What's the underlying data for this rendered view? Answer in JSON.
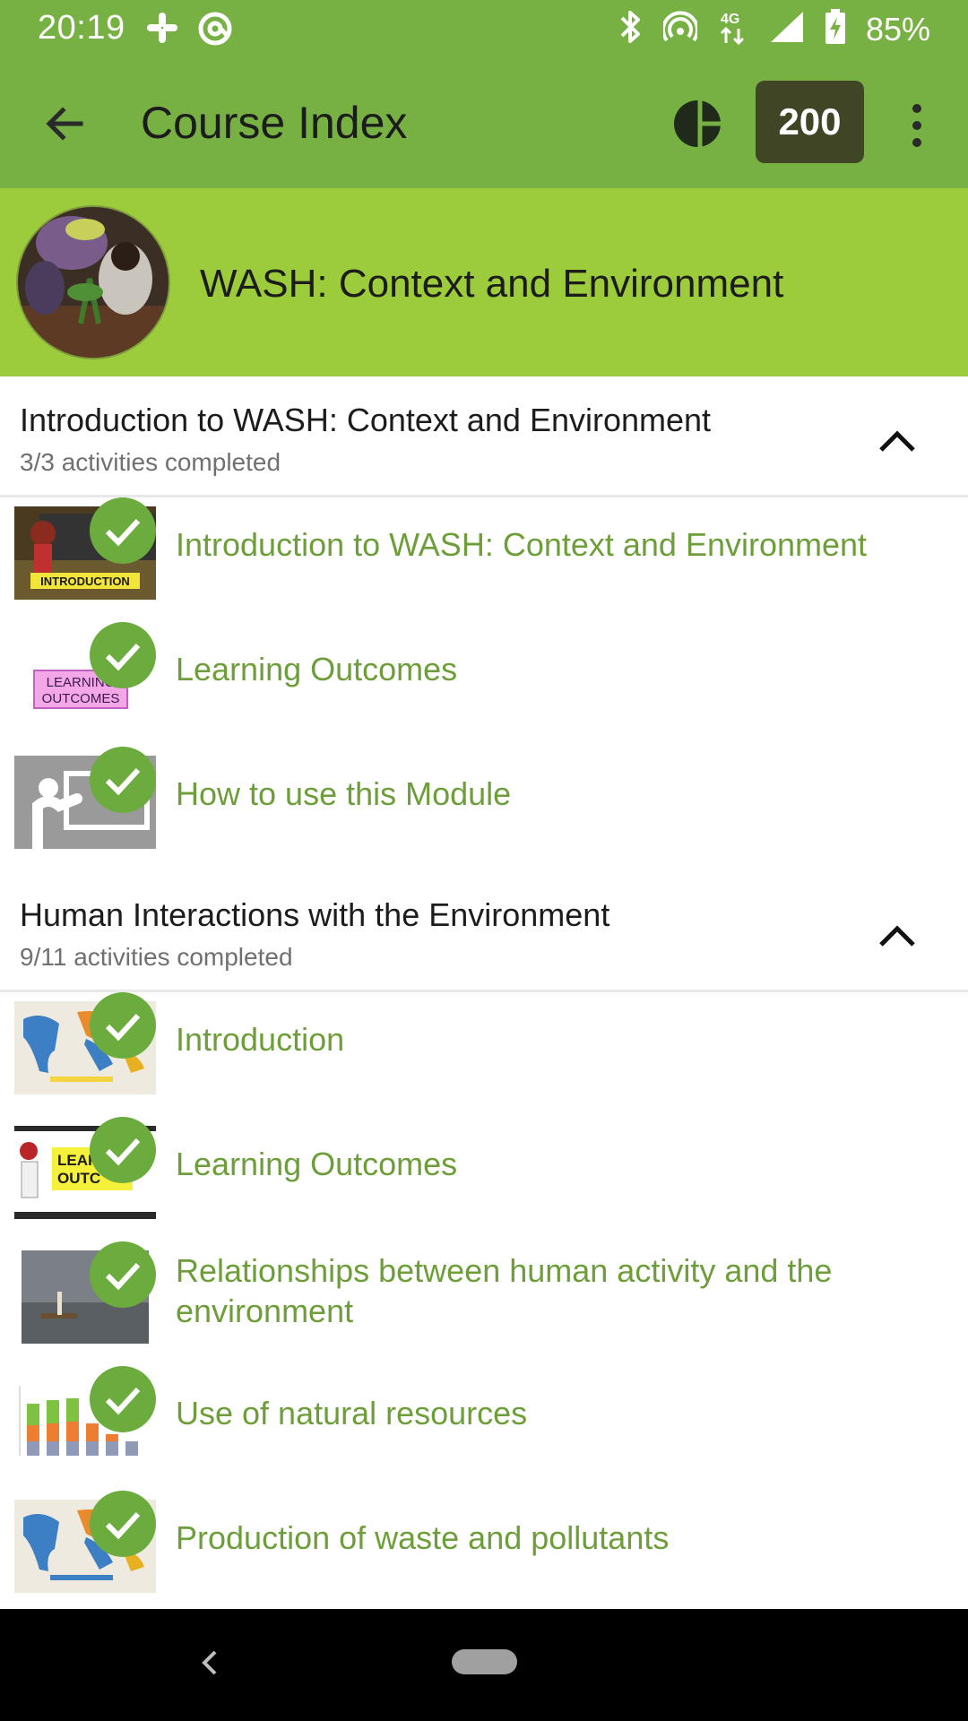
{
  "status_bar": {
    "time": "20:19",
    "battery": "85%",
    "network": "4G",
    "icons": [
      "slack-icon",
      "at-sign-icon",
      "bluetooth-icon",
      "hotspot-icon",
      "network-4g-icon",
      "signal-icon",
      "battery-charging-icon"
    ]
  },
  "app_bar": {
    "title": "Course Index",
    "points": "200",
    "icons": [
      "back-arrow-icon",
      "progress-pie-icon",
      "more-vert-icon"
    ]
  },
  "course": {
    "title": "WASH: Context and Environment"
  },
  "sections": [
    {
      "title": "Introduction to WASH: Context and Environment",
      "progress": "3/3  activities completed",
      "expanded": true,
      "activities": [
        {
          "label": "Introduction to WASH: Context and Environment",
          "completed": true,
          "thumb_text": "INTRODUCTION"
        },
        {
          "label": "Learning Outcomes",
          "completed": true,
          "thumb_text": "LEARNING OUTCOMES"
        },
        {
          "label": "How to use this Module",
          "completed": true
        }
      ]
    },
    {
      "title": "Human Interactions with the Environment",
      "progress": "9/11  activities completed",
      "expanded": true,
      "activities": [
        {
          "label": "Introduction",
          "completed": true
        },
        {
          "label": "Learning Outcomes",
          "completed": true,
          "thumb_text": "LEARNING OUTCOMES"
        },
        {
          "label": "Relationships between human activity and the environment",
          "completed": true
        },
        {
          "label": "Use of natural resources",
          "completed": true
        },
        {
          "label": "Production of waste and pollutants",
          "completed": true
        }
      ]
    }
  ],
  "colors": {
    "app_bar": "#77b043",
    "course_header": "#9ccb3b",
    "points_badge": "#404526",
    "activity_text": "#6e9e3a",
    "check_badge": "#6cac3e"
  }
}
